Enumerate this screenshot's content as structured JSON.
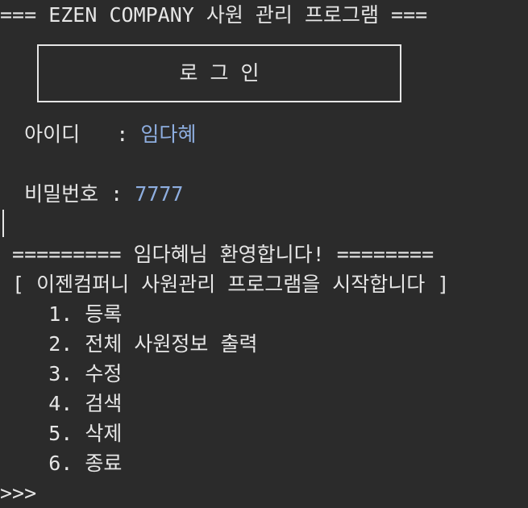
{
  "header": {
    "title": "=== EZEN COMPANY 사원 관리 프로그램 ==="
  },
  "login_box": {
    "title": "로 그 인"
  },
  "id_prompt": {
    "label": "  아이디   : ",
    "value": "임다혜"
  },
  "pw_prompt": {
    "label": "  비밀번호 : ",
    "value": "7777"
  },
  "welcome": {
    "text": " ========= 임다혜님 환영합니다! ========"
  },
  "start_message": {
    "text": " [ 이젠컴퍼니 사원관리 프로그램을 시작합니다 ]"
  },
  "menu": {
    "items": [
      "    1. 등록",
      "    2. 전체 사원정보 출력",
      "    3. 수정",
      "    4. 검색",
      "    5. 삭제",
      "    6. 종료"
    ]
  },
  "prompt": {
    "text": ">>>"
  }
}
